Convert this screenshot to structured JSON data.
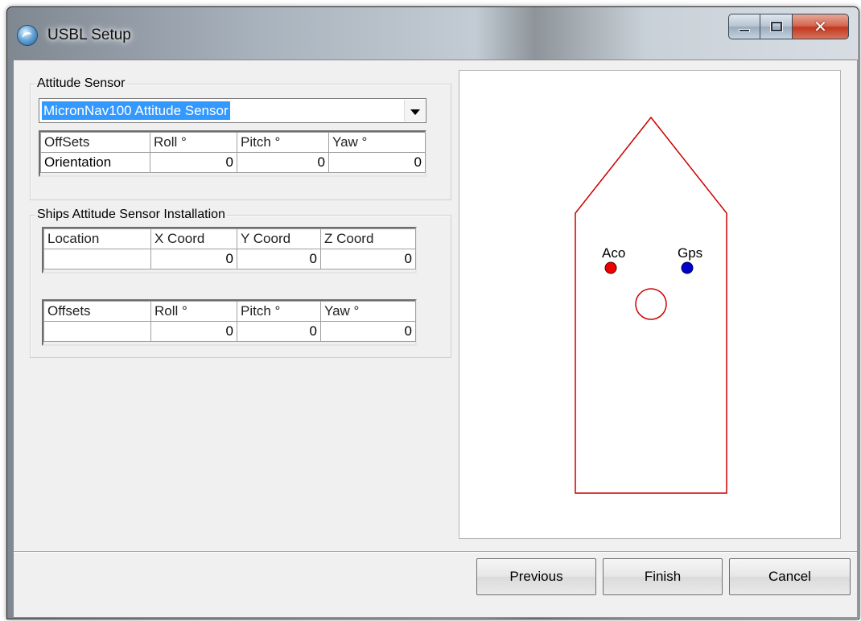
{
  "window": {
    "title": "USBL Setup",
    "icon": "usbl-app-icon",
    "controls": [
      "minimize-icon",
      "maximize-icon",
      "close-icon"
    ]
  },
  "attitude_sensor": {
    "group_label": "Attitude Sensor",
    "selected_sensor": "MicronNav100 Attitude Sensor",
    "offsets_table": {
      "headers": [
        "OffSets",
        "Roll °",
        "Pitch °",
        "Yaw °"
      ],
      "row": {
        "label": "Orientation",
        "roll": "0",
        "pitch": "0",
        "yaw": "0"
      }
    }
  },
  "installation": {
    "group_label": "Ships Attitude Sensor Installation",
    "location_table": {
      "headers": [
        "Location",
        "X Coord",
        "Y Coord",
        "Z Coord"
      ],
      "row": {
        "label": "",
        "x": "0",
        "y": "0",
        "z": "0"
      }
    },
    "offsets_table": {
      "headers": [
        "Offsets",
        "Roll °",
        "Pitch °",
        "Yaw °"
      ],
      "row": {
        "label": "",
        "roll": "0",
        "pitch": "0",
        "yaw": "0"
      }
    }
  },
  "ship_diagram": {
    "labels": {
      "aco": "Aco",
      "gps": "Gps"
    },
    "colors": {
      "hull": "#cc0000",
      "aco_marker": "#ee0000",
      "gps_marker": "#0000cc",
      "sensor_ring": "#cc0000"
    }
  },
  "buttons": {
    "previous": "Previous",
    "finish": "Finish",
    "cancel": "Cancel"
  }
}
